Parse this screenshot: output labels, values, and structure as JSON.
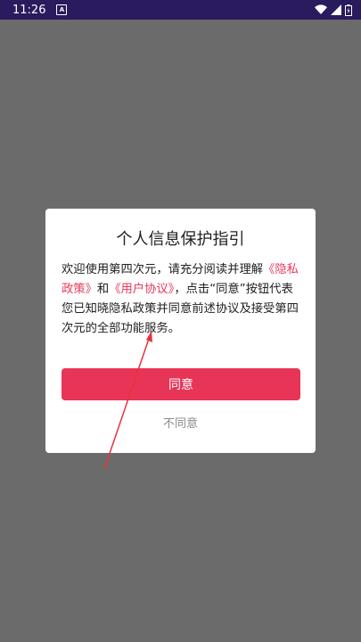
{
  "status_bar": {
    "time": "11:26",
    "notification_icon_glyph": "A",
    "icons": [
      "wifi-icon",
      "signal-icon",
      "battery-icon"
    ]
  },
  "dialog": {
    "title": "个人信息保护指引",
    "text_1": "欢迎使用第四次元，请充分阅读并理解",
    "privacy_link": "《隐私政策》",
    "text_2": "和",
    "user_agreement_link": "《用户协议》",
    "text_3": "，点击“同意”按钮代表您已知晓隐私政策并同意前述协议及接受第四次元的全部功能服务。",
    "agree_label": "同意",
    "disagree_label": "不同意"
  },
  "colors": {
    "status_bar": "#2a1a5e",
    "overlay": "#6b6b6b",
    "accent": "#e83456",
    "link": "#e8395a",
    "annotation_arrow": "#e8323c"
  }
}
